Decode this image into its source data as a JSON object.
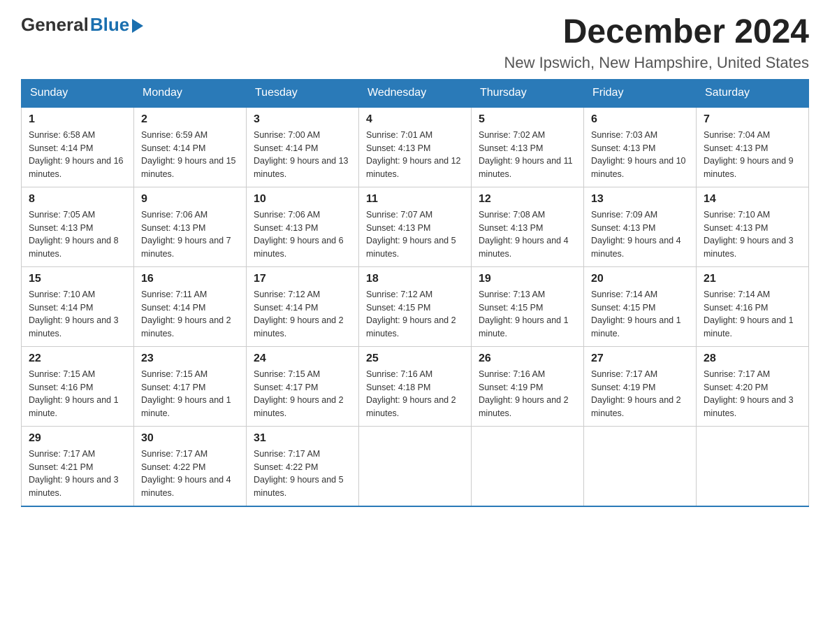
{
  "header": {
    "logo_general": "General",
    "logo_blue": "Blue",
    "month_title": "December 2024",
    "location": "New Ipswich, New Hampshire, United States"
  },
  "days_of_week": [
    "Sunday",
    "Monday",
    "Tuesday",
    "Wednesday",
    "Thursday",
    "Friday",
    "Saturday"
  ],
  "weeks": [
    [
      {
        "day": "1",
        "sunrise": "Sunrise: 6:58 AM",
        "sunset": "Sunset: 4:14 PM",
        "daylight": "Daylight: 9 hours and 16 minutes."
      },
      {
        "day": "2",
        "sunrise": "Sunrise: 6:59 AM",
        "sunset": "Sunset: 4:14 PM",
        "daylight": "Daylight: 9 hours and 15 minutes."
      },
      {
        "day": "3",
        "sunrise": "Sunrise: 7:00 AM",
        "sunset": "Sunset: 4:14 PM",
        "daylight": "Daylight: 9 hours and 13 minutes."
      },
      {
        "day": "4",
        "sunrise": "Sunrise: 7:01 AM",
        "sunset": "Sunset: 4:13 PM",
        "daylight": "Daylight: 9 hours and 12 minutes."
      },
      {
        "day": "5",
        "sunrise": "Sunrise: 7:02 AM",
        "sunset": "Sunset: 4:13 PM",
        "daylight": "Daylight: 9 hours and 11 minutes."
      },
      {
        "day": "6",
        "sunrise": "Sunrise: 7:03 AM",
        "sunset": "Sunset: 4:13 PM",
        "daylight": "Daylight: 9 hours and 10 minutes."
      },
      {
        "day": "7",
        "sunrise": "Sunrise: 7:04 AM",
        "sunset": "Sunset: 4:13 PM",
        "daylight": "Daylight: 9 hours and 9 minutes."
      }
    ],
    [
      {
        "day": "8",
        "sunrise": "Sunrise: 7:05 AM",
        "sunset": "Sunset: 4:13 PM",
        "daylight": "Daylight: 9 hours and 8 minutes."
      },
      {
        "day": "9",
        "sunrise": "Sunrise: 7:06 AM",
        "sunset": "Sunset: 4:13 PM",
        "daylight": "Daylight: 9 hours and 7 minutes."
      },
      {
        "day": "10",
        "sunrise": "Sunrise: 7:06 AM",
        "sunset": "Sunset: 4:13 PM",
        "daylight": "Daylight: 9 hours and 6 minutes."
      },
      {
        "day": "11",
        "sunrise": "Sunrise: 7:07 AM",
        "sunset": "Sunset: 4:13 PM",
        "daylight": "Daylight: 9 hours and 5 minutes."
      },
      {
        "day": "12",
        "sunrise": "Sunrise: 7:08 AM",
        "sunset": "Sunset: 4:13 PM",
        "daylight": "Daylight: 9 hours and 4 minutes."
      },
      {
        "day": "13",
        "sunrise": "Sunrise: 7:09 AM",
        "sunset": "Sunset: 4:13 PM",
        "daylight": "Daylight: 9 hours and 4 minutes."
      },
      {
        "day": "14",
        "sunrise": "Sunrise: 7:10 AM",
        "sunset": "Sunset: 4:13 PM",
        "daylight": "Daylight: 9 hours and 3 minutes."
      }
    ],
    [
      {
        "day": "15",
        "sunrise": "Sunrise: 7:10 AM",
        "sunset": "Sunset: 4:14 PM",
        "daylight": "Daylight: 9 hours and 3 minutes."
      },
      {
        "day": "16",
        "sunrise": "Sunrise: 7:11 AM",
        "sunset": "Sunset: 4:14 PM",
        "daylight": "Daylight: 9 hours and 2 minutes."
      },
      {
        "day": "17",
        "sunrise": "Sunrise: 7:12 AM",
        "sunset": "Sunset: 4:14 PM",
        "daylight": "Daylight: 9 hours and 2 minutes."
      },
      {
        "day": "18",
        "sunrise": "Sunrise: 7:12 AM",
        "sunset": "Sunset: 4:15 PM",
        "daylight": "Daylight: 9 hours and 2 minutes."
      },
      {
        "day": "19",
        "sunrise": "Sunrise: 7:13 AM",
        "sunset": "Sunset: 4:15 PM",
        "daylight": "Daylight: 9 hours and 1 minute."
      },
      {
        "day": "20",
        "sunrise": "Sunrise: 7:14 AM",
        "sunset": "Sunset: 4:15 PM",
        "daylight": "Daylight: 9 hours and 1 minute."
      },
      {
        "day": "21",
        "sunrise": "Sunrise: 7:14 AM",
        "sunset": "Sunset: 4:16 PM",
        "daylight": "Daylight: 9 hours and 1 minute."
      }
    ],
    [
      {
        "day": "22",
        "sunrise": "Sunrise: 7:15 AM",
        "sunset": "Sunset: 4:16 PM",
        "daylight": "Daylight: 9 hours and 1 minute."
      },
      {
        "day": "23",
        "sunrise": "Sunrise: 7:15 AM",
        "sunset": "Sunset: 4:17 PM",
        "daylight": "Daylight: 9 hours and 1 minute."
      },
      {
        "day": "24",
        "sunrise": "Sunrise: 7:15 AM",
        "sunset": "Sunset: 4:17 PM",
        "daylight": "Daylight: 9 hours and 2 minutes."
      },
      {
        "day": "25",
        "sunrise": "Sunrise: 7:16 AM",
        "sunset": "Sunset: 4:18 PM",
        "daylight": "Daylight: 9 hours and 2 minutes."
      },
      {
        "day": "26",
        "sunrise": "Sunrise: 7:16 AM",
        "sunset": "Sunset: 4:19 PM",
        "daylight": "Daylight: 9 hours and 2 minutes."
      },
      {
        "day": "27",
        "sunrise": "Sunrise: 7:17 AM",
        "sunset": "Sunset: 4:19 PM",
        "daylight": "Daylight: 9 hours and 2 minutes."
      },
      {
        "day": "28",
        "sunrise": "Sunrise: 7:17 AM",
        "sunset": "Sunset: 4:20 PM",
        "daylight": "Daylight: 9 hours and 3 minutes."
      }
    ],
    [
      {
        "day": "29",
        "sunrise": "Sunrise: 7:17 AM",
        "sunset": "Sunset: 4:21 PM",
        "daylight": "Daylight: 9 hours and 3 minutes."
      },
      {
        "day": "30",
        "sunrise": "Sunrise: 7:17 AM",
        "sunset": "Sunset: 4:22 PM",
        "daylight": "Daylight: 9 hours and 4 minutes."
      },
      {
        "day": "31",
        "sunrise": "Sunrise: 7:17 AM",
        "sunset": "Sunset: 4:22 PM",
        "daylight": "Daylight: 9 hours and 5 minutes."
      },
      null,
      null,
      null,
      null
    ]
  ]
}
